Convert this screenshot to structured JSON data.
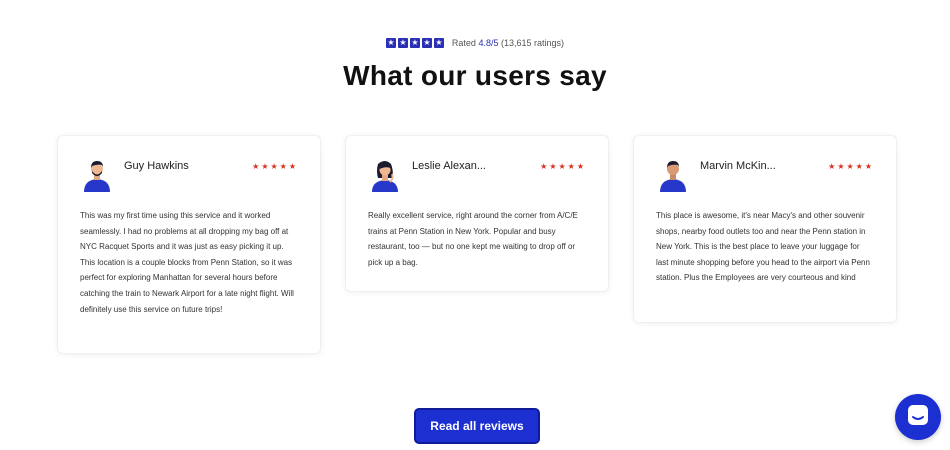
{
  "rating": {
    "prefix": "Rated",
    "score": "4.8/5",
    "count": "(13,615 ratings)",
    "star_color": "#2b2fb5"
  },
  "heading": "What our users say",
  "reviews": [
    {
      "name": "Guy Hawkins",
      "stars": "★★★★★",
      "avatar": "man-avatar-icon",
      "text": "This was my first time using this service and it worked seamlessly. I had no problems at all dropping my bag off at NYC Racquet Sports and it was just as easy picking it up. This location is a couple blocks from Penn Station, so it was perfect for exploring Manhattan for several hours before catching the train to Newark Airport for a late night flight. Will definitely use this service on future trips!"
    },
    {
      "name": "Leslie Alexan...",
      "stars": "★★★★★",
      "avatar": "woman-avatar-icon",
      "text": "Really excellent service, right around the corner from A/C/E trains at Penn Station in New York. Popular and busy restaurant, too — but no one kept me waiting to drop off or pick up a bag."
    },
    {
      "name": "Marvin McKin...",
      "stars": "★★★★★",
      "avatar": "man-avatar-icon",
      "text": "This place is awesome, it's near Macy's and other souvenir shops, nearby food outlets too and near the Penn station in New York. This is the best place to leave your luggage for last minute shopping before you head to the airport via Penn station. Plus the Employees are very courteous and kind"
    }
  ],
  "cta": {
    "label": "Read all reviews"
  },
  "colors": {
    "accent": "#1c2fd1",
    "review_star": "#d9301c"
  },
  "chat": {
    "icon": "chat-icon"
  }
}
